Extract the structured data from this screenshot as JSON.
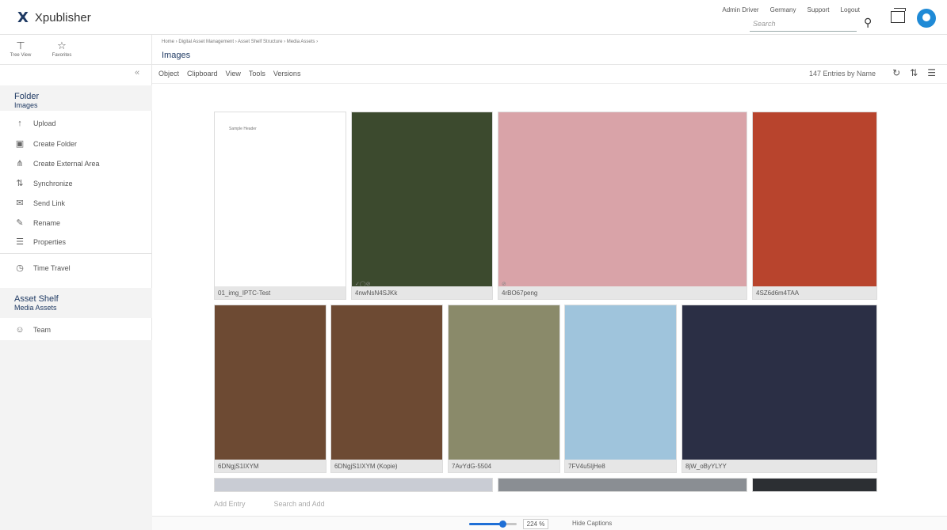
{
  "app": {
    "logo_mark": "X",
    "name": "Xpublisher"
  },
  "header": {
    "links": [
      "Admin Driver",
      "Germany",
      "Support",
      "Logout"
    ],
    "search_placeholder": "Search"
  },
  "left_panel": {
    "views": [
      {
        "label": "Tree View",
        "icon": "tree-icon"
      },
      {
        "label": "Favorites",
        "icon": "star-icon"
      }
    ],
    "folder": {
      "title": "Folder",
      "subtitle": "Images"
    },
    "actions": [
      {
        "label": "Upload",
        "icon": "upload-icon"
      },
      {
        "label": "Create Folder",
        "icon": "folder-plus-icon"
      },
      {
        "label": "Create External Area",
        "icon": "external-area-icon"
      },
      {
        "label": "Synchronize",
        "icon": "sync-icon"
      },
      {
        "label": "Send Link",
        "icon": "mail-icon"
      },
      {
        "label": "Rename",
        "icon": "rename-icon"
      },
      {
        "label": "Properties",
        "icon": "properties-icon"
      }
    ],
    "time_travel": {
      "label": "Time Travel",
      "icon": "clock-icon"
    },
    "asset_shelf": {
      "title": "Asset Shelf",
      "subtitle": "Media Assets"
    },
    "team": {
      "label": "Team",
      "icon": "team-icon"
    }
  },
  "breadcrumb": "Home  ›  Digital Asset Management  ›  Asset Shelf Structure  ›  Media Assets  ›",
  "page_title": "Images",
  "toolbar": {
    "menus": [
      "Object",
      "Clipboard",
      "View",
      "Tools",
      "Versions"
    ],
    "entries_label": "147 Entries by Name"
  },
  "gallery": {
    "items": [
      {
        "caption": "01_img_IPTC-Test",
        "marks": "",
        "color": "#ffffff",
        "img_text": "Sample Header"
      },
      {
        "caption": "4nwNsN4SJKk",
        "marks": "✓◯⊘",
        "color": "#3c4a2e",
        "img_text": ""
      },
      {
        "caption": "4rBO67peng",
        "marks": "⊘",
        "color": "#d9a3a8",
        "img_text": ""
      },
      {
        "caption": "4SZ6d6m4TAA",
        "marks": "",
        "color": "#b8442d",
        "img_text": ""
      },
      {
        "caption": "6DNgjS1IXYM",
        "marks": "",
        "color": "#6d4a33",
        "img_text": ""
      },
      {
        "caption": "6DNgjS1IXYM (Kopie)",
        "marks": "",
        "color": "#6d4a33",
        "img_text": ""
      },
      {
        "caption": "7AvYdG-5504",
        "marks": "",
        "color": "#8a8a6a",
        "img_text": ""
      },
      {
        "caption": "7FV4u5IjHe8",
        "marks": "",
        "color": "#9fc4dc",
        "img_text": ""
      },
      {
        "caption": "8jW_oByYLYY",
        "marks": "",
        "color": "#2b2f45",
        "img_text": ""
      }
    ],
    "add_entry": "Add Entry",
    "search_and_add": "Search and Add"
  },
  "bottom": {
    "zoom_fraction": 0.7,
    "zoom_label": "224 %",
    "hide_captions": "Hide Captions"
  }
}
